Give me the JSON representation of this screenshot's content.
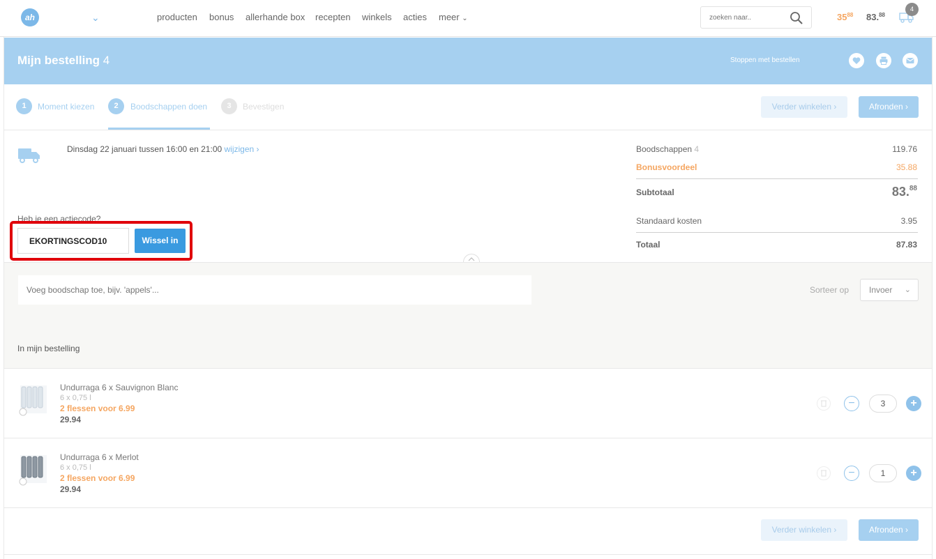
{
  "nav": {
    "logo_text": "ah",
    "links": [
      "producten",
      "bonus",
      "allerhande box",
      "recepten",
      "winkels",
      "acties",
      "meer"
    ],
    "search_placeholder": "zoeken naar..",
    "bonus_total_main": "35",
    "bonus_total_cents": "88",
    "cart_total_main": "83.",
    "cart_total_cents": "88",
    "cart_count": "4",
    "colors": {
      "brand": "#7cb8e8",
      "bonus": "#f5a661"
    }
  },
  "header": {
    "title": "Mijn bestelling",
    "count": "4",
    "stop_ordering": "Stoppen met bestellen",
    "icons": [
      "heart-icon",
      "print-icon",
      "mail-icon"
    ]
  },
  "steps": {
    "items": [
      {
        "num": "1",
        "label": "Moment kiezen"
      },
      {
        "num": "2",
        "label": "Boodschappen doen"
      },
      {
        "num": "3",
        "label": "Bevestigen"
      }
    ],
    "continue_shopping": "Verder winkelen",
    "finish": "Afronden"
  },
  "delivery": {
    "text": "Dinsdag 22 januari tussen 16:00 en 21:00",
    "change": "wijzigen"
  },
  "summary": {
    "groceries_label": "Boodschappen",
    "groceries_count": "4",
    "groceries_value": "119.76",
    "bonus_label": "Bonusvoordeel",
    "bonus_value": "35.88",
    "subtotal_label": "Subtotaal",
    "subtotal_main": "83.",
    "subtotal_cents": "88",
    "standard_costs_label": "Standaard kosten",
    "standard_costs_value": "3.95",
    "total_label": "Totaal",
    "total_value": "87.83"
  },
  "promo": {
    "question": "Heb je een actiecode?",
    "code_value": "EKORTINGSCOD10",
    "redeem_label": "Wissel in"
  },
  "list": {
    "add_placeholder": "Voeg boodschap toe, bijv. 'appels'...",
    "sort_label": "Sorteer op",
    "sort_value": "Invoer",
    "heading": "In mijn bestelling"
  },
  "products": [
    {
      "name": "Undurraga 6 x Sauvignon Blanc",
      "size": "6 x 0,75 l",
      "promo": "2 flessen voor 6.99",
      "price": "29.94",
      "qty": "3"
    },
    {
      "name": "Undurraga 6 x Merlot",
      "size": "6 x 0,75 l",
      "promo": "2 flessen voor 6.99",
      "price": "29.94",
      "qty": "1"
    }
  ],
  "footer": {
    "continue_shopping": "Verder winkelen",
    "finish": "Afronden"
  }
}
